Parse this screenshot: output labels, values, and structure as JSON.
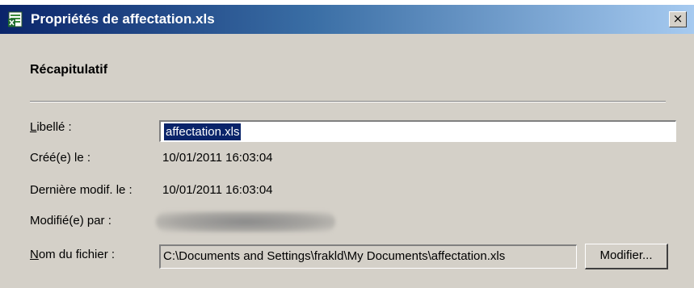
{
  "window": {
    "title": "Propriétés de affectation.xls",
    "close_symbol": "×",
    "icon": "excel-file-icon"
  },
  "summary": {
    "heading": "Récapitulatif"
  },
  "fields": {
    "name": {
      "label_key": "L",
      "label_rest": "ibellé :",
      "value": "affectation.xls"
    },
    "created": {
      "label": "Créé(e) le :",
      "value": "10/01/2011 16:03:04"
    },
    "modified": {
      "label": "Dernière modif. le :",
      "value": "10/01/2011 16:03:04"
    },
    "modified_by": {
      "label": "Modifié(e) par :"
    },
    "filename": {
      "label_key": "N",
      "label_rest": "om du fichier :",
      "value": "C:\\Documents and Settings\\frakld\\My Documents\\affectation.xls"
    }
  },
  "buttons": {
    "modify": "Modifier..."
  },
  "colors": {
    "titlebar_start": "#0a246a",
    "titlebar_end": "#a6caf0",
    "dialog_bg": "#d4d0c8",
    "selection_bg": "#0a246a"
  }
}
